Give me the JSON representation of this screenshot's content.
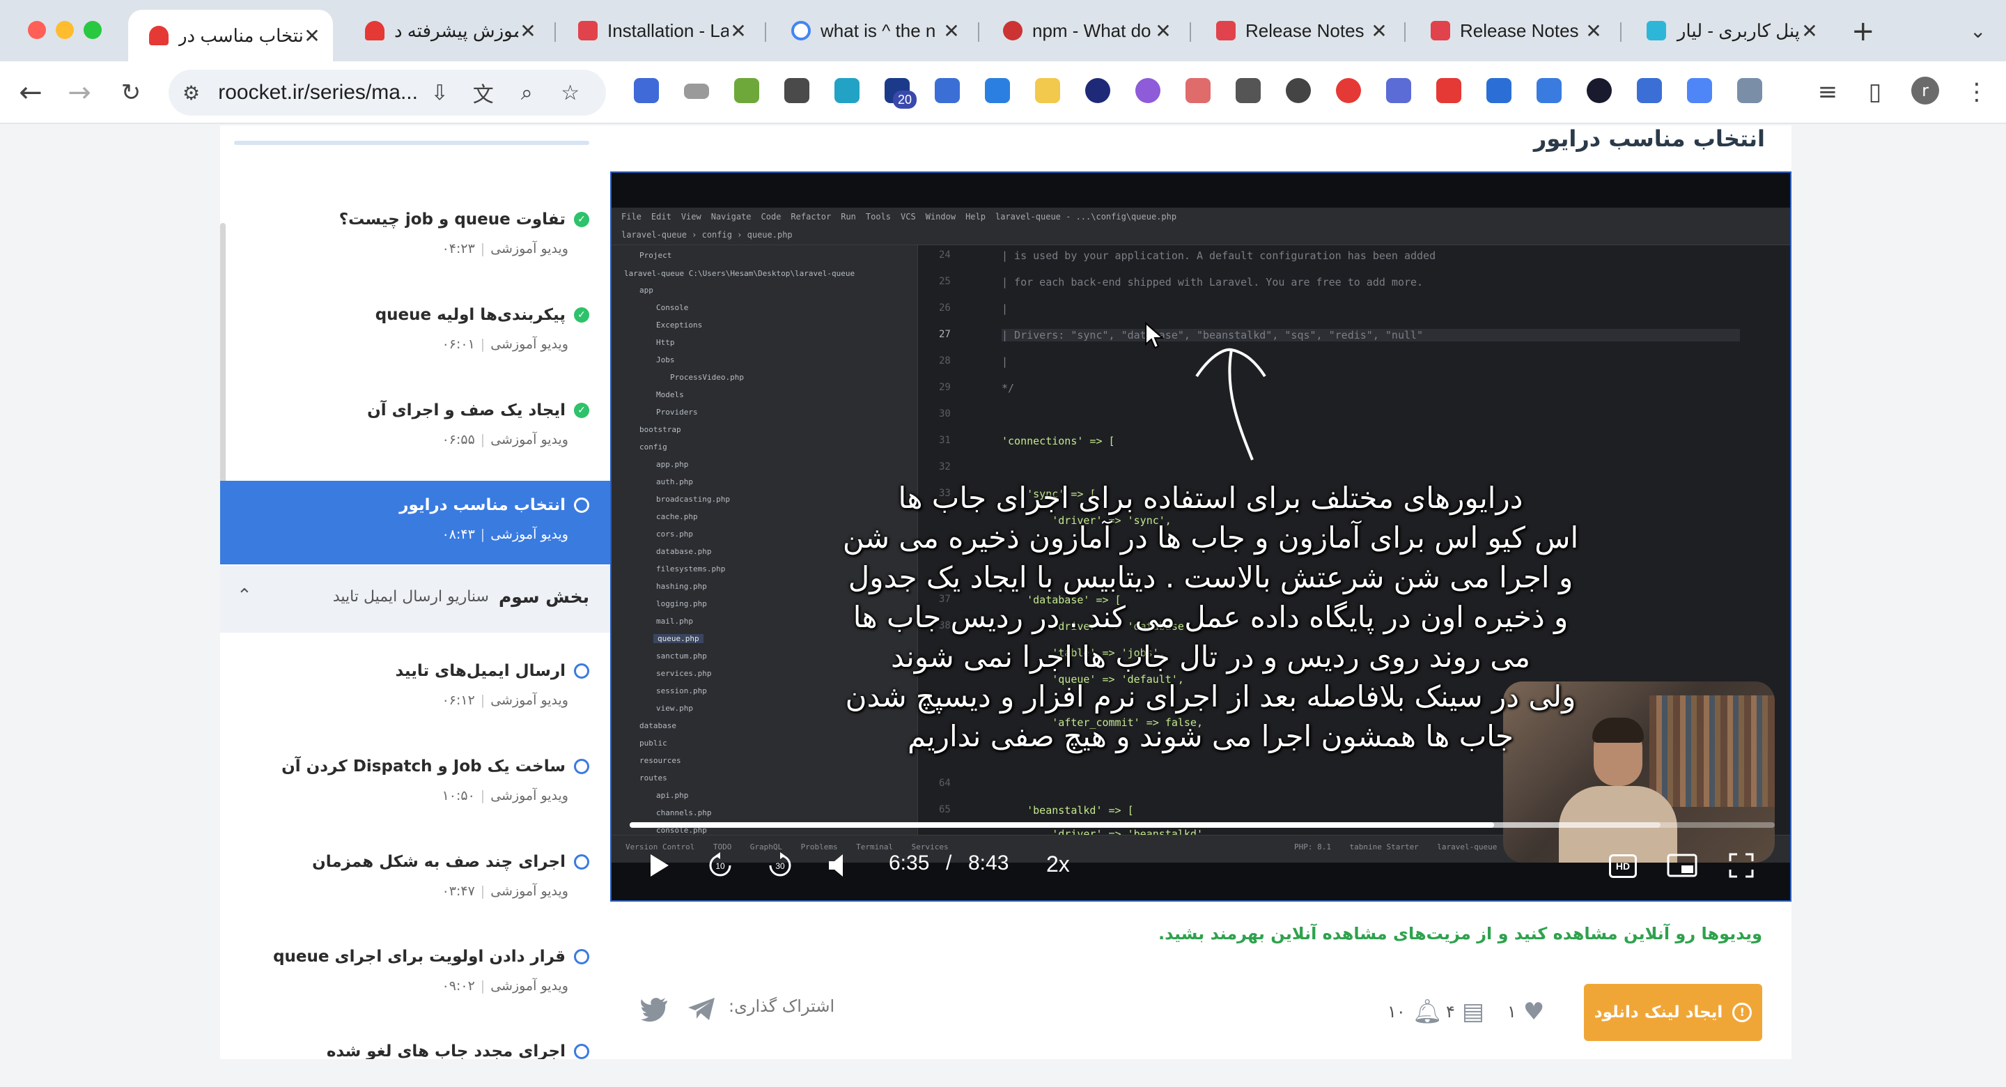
{
  "browser": {
    "tabs": [
      {
        "title": "انتخاب مناسب در",
        "active": true,
        "favicon_color": "#e53935"
      },
      {
        "title": "آموزش پیشرفته د",
        "active": false,
        "favicon_color": "#e53935"
      },
      {
        "title": "Installation - La",
        "active": false,
        "favicon_color": "#e0434b"
      },
      {
        "title": "what is ^ the n",
        "active": false,
        "favicon_color": "#4285f4"
      },
      {
        "title": "npm - What do",
        "active": false,
        "favicon_color": "#cc3333"
      },
      {
        "title": "Release Notes",
        "active": false,
        "favicon_color": "#e0434b"
      },
      {
        "title": "Release Notes",
        "active": false,
        "favicon_color": "#e0434b"
      },
      {
        "title": "پنل کاربری - لیارا",
        "active": false,
        "favicon_color": "#2db6d8"
      }
    ],
    "new_tab_icon": "+",
    "tab_menu_icon": "chevron-down",
    "url": "roocket.ir/series/ma...",
    "extension_badge": "20",
    "profile_initial": "r"
  },
  "page": {
    "title": "انتخاب مناسب درایور"
  },
  "sidebar": {
    "lessons_before": [
      {
        "title": "تفاوت queue و job چیست؟",
        "type": "ویدیو آموزشی",
        "duration": "۰۴:۲۳",
        "status": "done"
      },
      {
        "title": "پیکربندی‌ها اولیه queue",
        "type": "ویدیو آموزشی",
        "duration": "۰۶:۰۱",
        "status": "done"
      },
      {
        "title": "ایجاد یک صف و اجرای آن",
        "type": "ویدیو آموزشی",
        "duration": "۰۶:۵۵",
        "status": "done"
      },
      {
        "title": "انتخاب مناسب درایور",
        "type": "ویدیو آموزشی",
        "duration": "۰۸:۴۳",
        "status": "current"
      }
    ],
    "section": {
      "label": "بخش سوم",
      "subtitle": "سناریو ارسال ایمیل تایید"
    },
    "lessons_after": [
      {
        "title": "ارسال ایمیل‌های تایید",
        "type": "ویدیو آموزشی",
        "duration": "۰۶:۱۲",
        "status": "todo"
      },
      {
        "title": "ساخت یک Job و Dispatch کردن آن",
        "type": "ویدیو آموزشی",
        "duration": "۱۰:۵۰",
        "status": "todo"
      },
      {
        "title": "اجرای چند صف به شکل همزمان",
        "type": "ویدیو آموزشی",
        "duration": "۰۳:۴۷",
        "status": "todo"
      },
      {
        "title": "قرار دادن اولویت برای اجرای queue",
        "type": "ویدیو آموزشی",
        "duration": "۰۹:۰۲",
        "status": "todo"
      },
      {
        "title": "اجرای مجدد جاب های لغو شده",
        "type": "",
        "duration": "",
        "status": "todo"
      }
    ]
  },
  "player": {
    "subtitle_lines": [
      "درایورهای مختلف برای استفاده برای اجرای جاب ها",
      "اس کیو اس برای آمازون و جاب ها در آمازون ذخیره می شن",
      "و اجرا می شن شرعتش بالاست . دیتابیس با ایجاد یک جدول",
      "و ذخیره اون در پایگاه داده عمل می کند . در ردیس جاب ها",
      "می روند روی ردیس و در تال جاب ها اجرا نمی شوند",
      "ولی در سینک بلافاصله بعد از اجرای نرم افزار و دیسپچ شدن",
      "جاب ها همشون اجرا می شوند و هیچ صفی نداریم"
    ],
    "current_time": "6:35",
    "time_separator": "/",
    "duration": "8:43",
    "speed": "2x",
    "progress_played": 0.755,
    "progress_buffered": 0.9,
    "hd_label": "HD",
    "ide": {
      "menu": [
        "File",
        "Edit",
        "View",
        "Navigate",
        "Code",
        "Refactor",
        "Run",
        "Tools",
        "VCS",
        "Window",
        "Help",
        "laravel-queue - ...\\config\\queue.php"
      ],
      "breadcrumb": "laravel-queue  ›  config  ›  queue.php",
      "panel_title": "Project",
      "tree": [
        "laravel-queue  C:\\Users\\Hesam\\Desktop\\laravel-queue",
        "app",
        "Console",
        "Exceptions",
        "Http",
        "Jobs",
        "ProcessVideo.php",
        "Models",
        "Providers",
        "bootstrap",
        "config",
        "app.php",
        "auth.php",
        "broadcasting.php",
        "cache.php",
        "cors.php",
        "database.php",
        "filesystems.php",
        "hashing.php",
        "logging.php",
        "mail.php",
        "queue.php",
        "sanctum.php",
        "services.php",
        "session.php",
        "view.php",
        "database",
        "public",
        "resources",
        "routes",
        "api.php",
        "channels.php",
        "console.php"
      ],
      "line_numbers": [
        "24",
        "25",
        "26",
        "27",
        "28",
        "29",
        "30",
        "31",
        "32",
        "33",
        "37",
        "38",
        "64",
        "65"
      ],
      "code_lines": [
        "| is used by your application. A default configuration has been added",
        "| for each back-end shipped with Laravel. You are free to add more.",
        "|",
        "| Drivers: \"sync\", \"database\", \"beanstalkd\", \"sqs\", \"redis\", \"null\"",
        "|",
        "*/",
        "",
        "'connections' => [",
        "",
        "    'sync' => [",
        "        'driver' => 'sync',",
        "    'database' => [",
        "        'driver' => 'database',",
        "        'table' => 'jobs',",
        "        'queue' => 'default',",
        "        'after_commit' => false,",
        "    'beanstalkd' => [",
        "        'driver' => 'beanstalkd',"
      ],
      "highlighted_word": "database",
      "status_left": "Version Control    TODO    GraphQL    Problems    Terminal    Services",
      "status_right": "PHP: 8.1    tabnine Starter    laravel-queue    Material Oceanic"
    }
  },
  "below_player": {
    "online_note": "ویدیوها رو آنلاین مشاهده کنید و از مزیت‌های مشاهده آنلاین بهرمند بشید.",
    "download_button": "ایجاد لینک دانلود",
    "likes": "۱",
    "comments": "۴",
    "notifications": "۱۰",
    "share_label": "اشتراک گذاری:"
  }
}
